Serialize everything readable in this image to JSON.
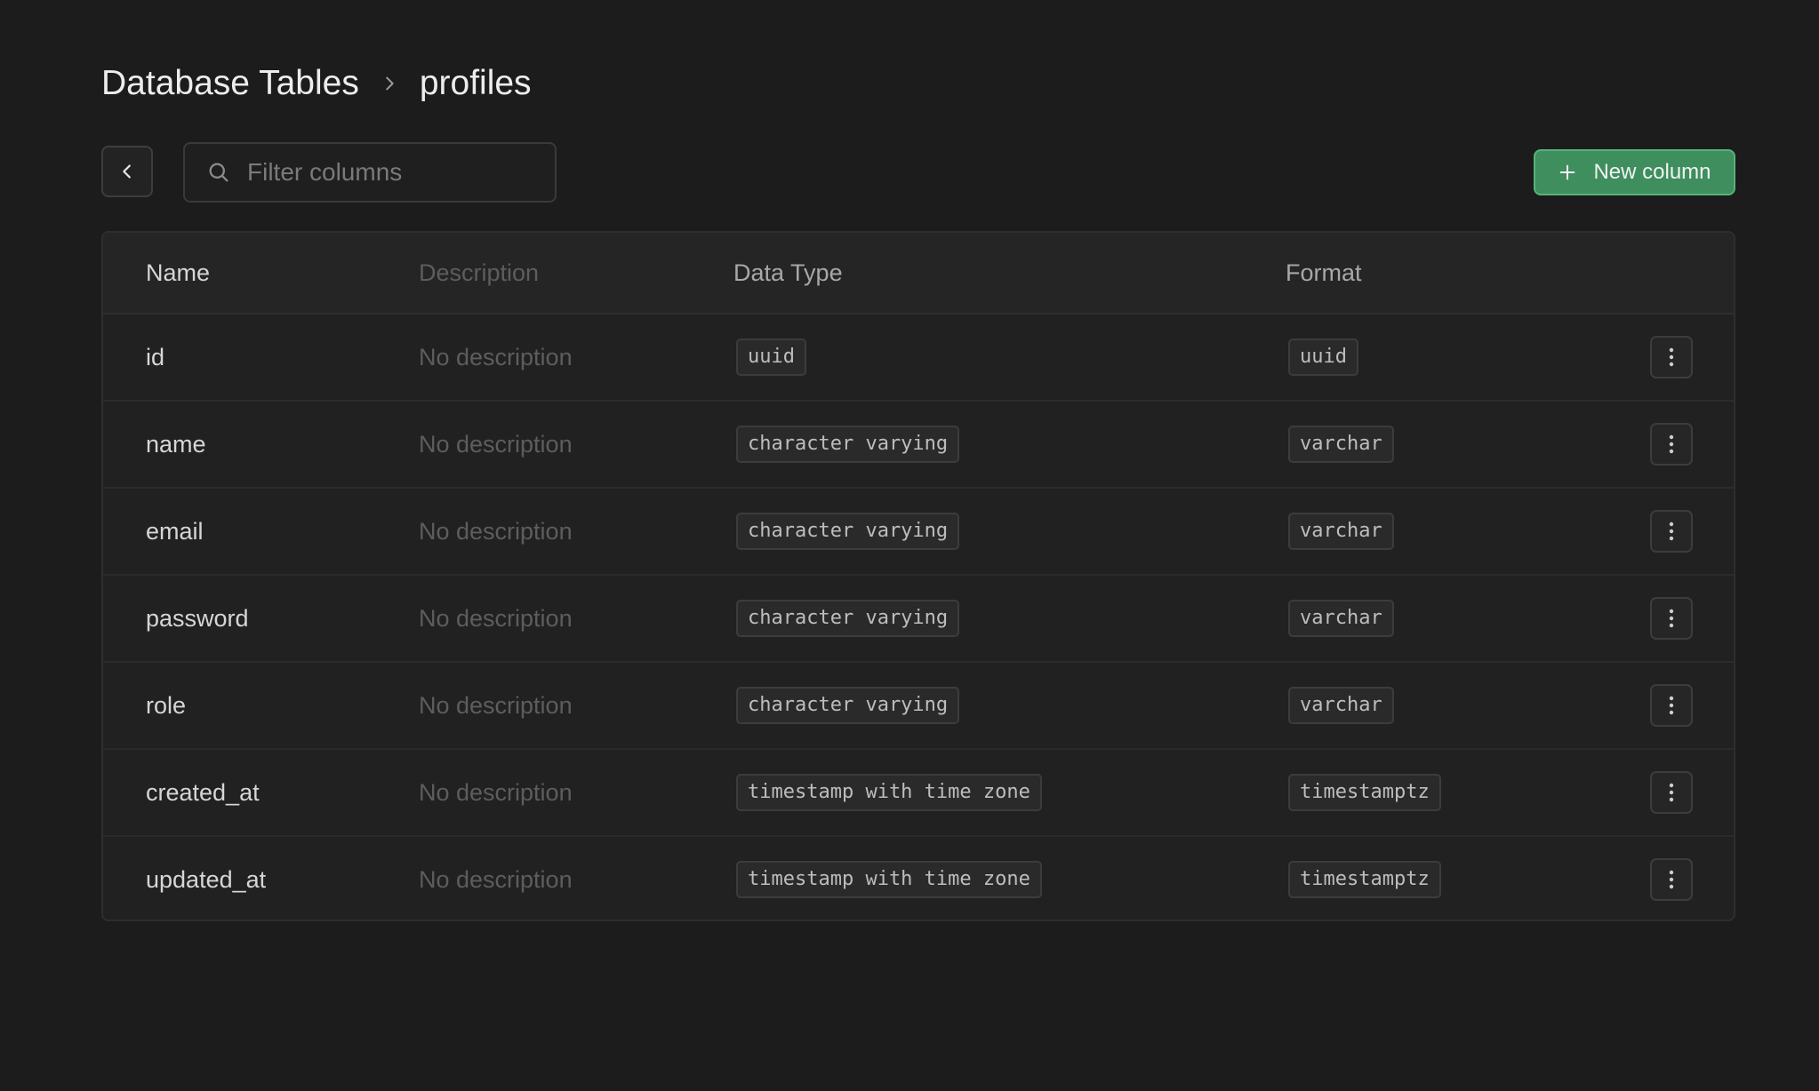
{
  "breadcrumb": {
    "root": "Database Tables",
    "current": "profiles",
    "separator_icon": "chevron-right-icon"
  },
  "toolbar": {
    "back_icon": "chevron-left-icon",
    "search_icon": "search-icon",
    "search_placeholder": "Filter columns",
    "search_value": "",
    "new_column_label": "New column",
    "new_column_icon": "plus-icon",
    "accent_color": "#3e8e5e"
  },
  "table": {
    "headers": {
      "name": "Name",
      "description": "Description",
      "data_type": "Data Type",
      "format": "Format"
    },
    "rows": [
      {
        "name": "id",
        "description": "No description",
        "data_type": "uuid",
        "format": "uuid"
      },
      {
        "name": "name",
        "description": "No description",
        "data_type": "character varying",
        "format": "varchar"
      },
      {
        "name": "email",
        "description": "No description",
        "data_type": "character varying",
        "format": "varchar"
      },
      {
        "name": "password",
        "description": "No description",
        "data_type": "character varying",
        "format": "varchar"
      },
      {
        "name": "role",
        "description": "No description",
        "data_type": "character varying",
        "format": "varchar"
      },
      {
        "name": "created_at",
        "description": "No description",
        "data_type": "timestamp with time zone",
        "format": "timestamptz"
      },
      {
        "name": "updated_at",
        "description": "No description",
        "data_type": "timestamp with time zone",
        "format": "timestamptz"
      }
    ],
    "row_action_icon": "more-vertical-icon"
  }
}
